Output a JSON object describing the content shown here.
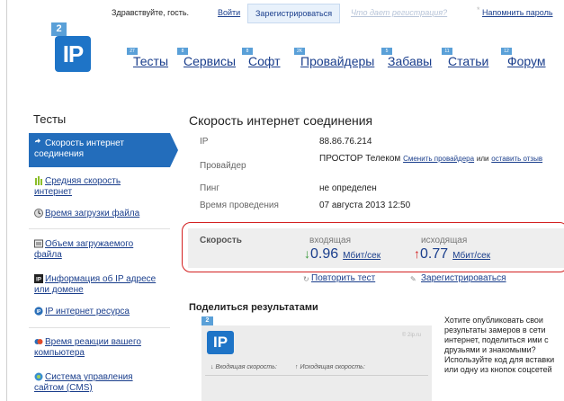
{
  "auth": {
    "greeting": "Здравствуйте, гость.",
    "login": "Войти",
    "register": "Зарегистрироваться",
    "why_register": "Что дает регистрация?",
    "remind_password": "Напомнить пароль"
  },
  "logo": {
    "small": "2",
    "big": "IP"
  },
  "nav": [
    {
      "label": "Тесты",
      "badge": "27"
    },
    {
      "label": "Сервисы",
      "badge": "8"
    },
    {
      "label": "Софт",
      "badge": "8"
    },
    {
      "label": "Провайдеры",
      "badge": "2K"
    },
    {
      "label": "Забавы",
      "badge": "5"
    },
    {
      "label": "Статьи",
      "badge": "11"
    },
    {
      "label": "Форум",
      "badge": "12"
    }
  ],
  "sidebar": {
    "title": "Тесты",
    "items": [
      {
        "label": "Скорость интернет соединения",
        "icon": "arrow-icon"
      },
      {
        "label": "Средняя скорость интернет",
        "icon": "bars-icon"
      },
      {
        "label": "Время загрузки файла",
        "icon": "clock-icon"
      },
      {
        "label": "Объем загружаемого файла",
        "icon": "storage-icon"
      },
      {
        "label": "Информация об IP адресе или домене",
        "icon": "ip-icon"
      },
      {
        "label": "IP интернет ресурса",
        "icon": "globe-icon"
      },
      {
        "label": "Время реакции вашего компьютера",
        "icon": "reaction-icon"
      },
      {
        "label": "Система управления сайтом (CMS)",
        "icon": "cms-icon"
      }
    ]
  },
  "main": {
    "title": "Скорость интернет соединения",
    "rows": [
      {
        "label": "IP",
        "value": "88.86.76.214"
      },
      {
        "label": "Провайдер",
        "value": "ПРОСТОР Телеком",
        "link1": "Сменить провайдера",
        "sep": "или",
        "link2": "оставить отзыв"
      },
      {
        "label": "Пинг",
        "value": "не определен"
      },
      {
        "label": "Время проведения",
        "value": "07 августа 2013 12:50"
      }
    ],
    "speed": {
      "label": "Скорость",
      "in_label": "входящая",
      "in_value": "0.96",
      "out_label": "исходящая",
      "out_value": "0.77",
      "unit": "Мбит/сек"
    },
    "repeat": "Повторить тест",
    "register": "Зарегистрироваться",
    "share_title": "Поделиться результатами",
    "widget": {
      "small": "2",
      "logo": "IP",
      "source": "© 2ip.ru",
      "in_label": "↓ Входящая скорость:",
      "out_label": "↑ Исходящая скорость:"
    },
    "share_text": "Хотите опубликовать свои результаты замеров в сети интернет, поделиться ими с друзьями и знакомыми? Используйте код для вставки или одну из кнопок соцсетей"
  },
  "colors": {
    "accent": "#236dbb",
    "link": "#1a3e8c",
    "highlight_border": "#d32020"
  }
}
